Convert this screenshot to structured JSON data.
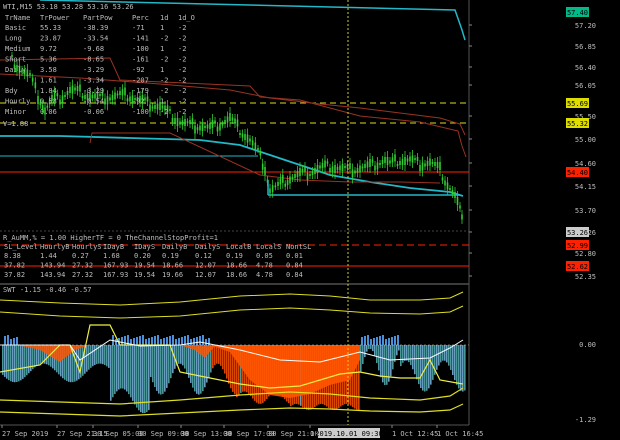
{
  "header": {
    "symbol_line": "WTI,M15  53.18 53.28 53.16 53.26",
    "tables": {
      "trend": {
        "headers": [
          "TrName",
          "TrPower",
          "PartPow",
          "Perc",
          "1d",
          "1d_O"
        ],
        "rows": [
          [
            "Basic",
            "55.33",
            "-38.39",
            "-71",
            "1",
            "-2"
          ],
          [
            "Long",
            "23.87",
            "-33.54",
            "-141",
            "-2",
            "-2"
          ],
          [
            "Medium",
            "9.72",
            "-9.68",
            "-100",
            "1",
            "-2"
          ],
          [
            "Short",
            "5.36",
            "-8.65",
            "-161",
            "-2",
            "-2"
          ],
          [
            "Daily",
            "3.58",
            "-3.29",
            "-92",
            "1",
            "-2"
          ],
          [
            "",
            "1.61",
            "-3.34",
            "-207",
            "-2",
            "-2"
          ],
          [
            "Bdy",
            "1.84",
            "-3.29",
            "-179",
            "-2",
            "-2"
          ],
          [
            "Hourly",
            "0.58",
            "-0.54",
            "-92",
            "1",
            "-2"
          ],
          [
            "Minor",
            "0.06",
            "-0.06",
            "-100",
            "-2",
            "-2"
          ]
        ],
        "extra": "V=1.88"
      },
      "stats": {
        "line": "R_AuMM,% = 1.00      HigherTF = 0      TheChannelStopProfit=1",
        "headers": [
          "SL_Level",
          "HourlyB",
          "HourlyS",
          "IDayB",
          "IDayS",
          "DailyB",
          "DailyS",
          "LocalB",
          "LocalS",
          "NontSL"
        ],
        "rows": [
          [
            "8.38",
            "1.44",
            "0.27",
            "1.68",
            "0.20",
            "0.19",
            "0.12",
            "0.19",
            "0.05",
            "0.01"
          ],
          [
            "37.82",
            "143.94",
            "27.32",
            "167.93",
            "19.54",
            "18.66",
            "12.07",
            "18.66",
            "4.78",
            "0.84"
          ],
          [
            "37.82",
            "143.94",
            "27.32",
            "167.93",
            "19.54",
            "19.66",
            "12.07",
            "18.66",
            "4.78",
            "0.84"
          ]
        ]
      }
    }
  },
  "price_axis": {
    "labels": [
      "57.20",
      "56.85",
      "56.40",
      "56.05",
      "55.50",
      "55.00",
      "54.60",
      "54.15",
      "53.70",
      "53.26",
      "52.80",
      "52.35"
    ],
    "tags": [
      {
        "text": "57.40",
        "color": "#00bb88"
      },
      {
        "text": "55.69",
        "color": "#dddd00"
      },
      {
        "text": "55.32",
        "color": "#dddd00"
      },
      {
        "text": "54.40",
        "color": "#ff2200"
      },
      {
        "text": "53.26",
        "color": "#cccccc"
      },
      {
        "text": "52.99",
        "color": "#ff2200"
      },
      {
        "text": "52.62",
        "color": "#ff2200"
      }
    ]
  },
  "indicator": {
    "title": "SWT -1.15 -0.46 -0.57",
    "axis_labels": [
      "0.00",
      "-1.29"
    ]
  },
  "time_axis": {
    "labels": [
      "27 Sep 2019",
      "27 Sep 21:15",
      "30 Sep 05:00",
      "30 Sep 09:00",
      "30 Sep 13:00",
      "30 Sep 17:00",
      "30 Sep 21:00",
      "1 Oct",
      "1 Oct 12:45",
      "1 Oct 16:45"
    ],
    "cursor_label": "2019.10.01 09:30"
  },
  "colors": {
    "bg": "#000000",
    "candle": "#33cc33",
    "cyan": "#22b8c8",
    "darkred": "#993322",
    "yellow": "#dddd22",
    "red": "#ff2200",
    "orange": "#ff5500",
    "blue": "#4a90d9",
    "grid": "#2a2a2a"
  }
}
